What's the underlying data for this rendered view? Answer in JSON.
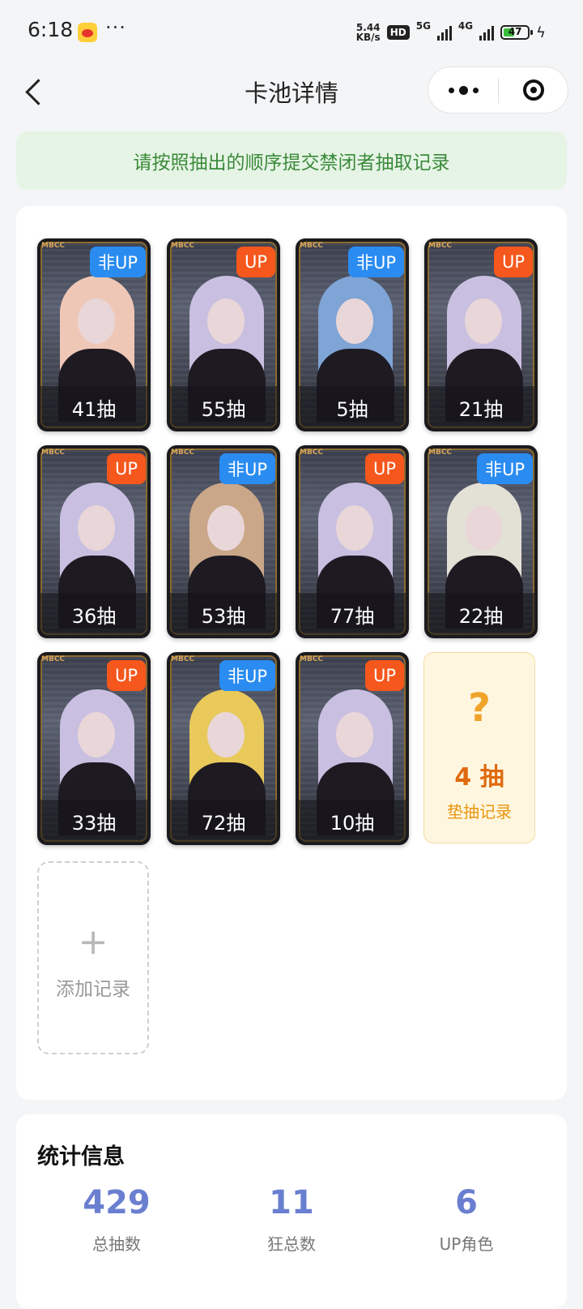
{
  "status_bar": {
    "time": "6:18",
    "speed_value": "5.44",
    "speed_unit": "KB/s",
    "hd": "HD",
    "net1": "5G",
    "net2": "4G",
    "battery": "47"
  },
  "header": {
    "title": "卡池详情"
  },
  "notice": "请按照抽出的顺序提交禁闭者抽取记录",
  "cards": [
    {
      "tag": "非UP",
      "count": "41抽",
      "hair": "#efc7b6"
    },
    {
      "tag": "UP",
      "count": "55抽",
      "hair": "#c9bfe0"
    },
    {
      "tag": "非UP",
      "count": "5抽",
      "hair": "#7fa4d6"
    },
    {
      "tag": "UP",
      "count": "21抽",
      "hair": "#c9bfe0"
    },
    {
      "tag": "UP",
      "count": "36抽",
      "hair": "#c9bfe0"
    },
    {
      "tag": "非UP",
      "count": "53抽",
      "hair": "#c9a788"
    },
    {
      "tag": "UP",
      "count": "77抽",
      "hair": "#c9bfe0"
    },
    {
      "tag": "非UP",
      "count": "22抽",
      "hair": "#e3e0d6"
    },
    {
      "tag": "UP",
      "count": "33抽",
      "hair": "#c9bfe0"
    },
    {
      "tag": "非UP",
      "count": "72抽",
      "hair": "#e8c95a"
    },
    {
      "tag": "UP",
      "count": "10抽",
      "hair": "#c9bfe0"
    }
  ],
  "pending": {
    "icon": "?",
    "count": "4 抽",
    "label": "垫抽记录"
  },
  "add_record": {
    "plus": "+",
    "label": "添加记录"
  },
  "stats": {
    "title": "统计信息",
    "items": [
      {
        "value": "429",
        "label": "总抽数"
      },
      {
        "value": "11",
        "label": "狂总数"
      },
      {
        "value": "6",
        "label": "UP角色"
      }
    ]
  },
  "colors": {
    "up_badge": "#f5571c",
    "nonup_badge": "#2a8cf0",
    "stat_number": "#6a7fd0",
    "notice_text": "#3a8a3a"
  }
}
